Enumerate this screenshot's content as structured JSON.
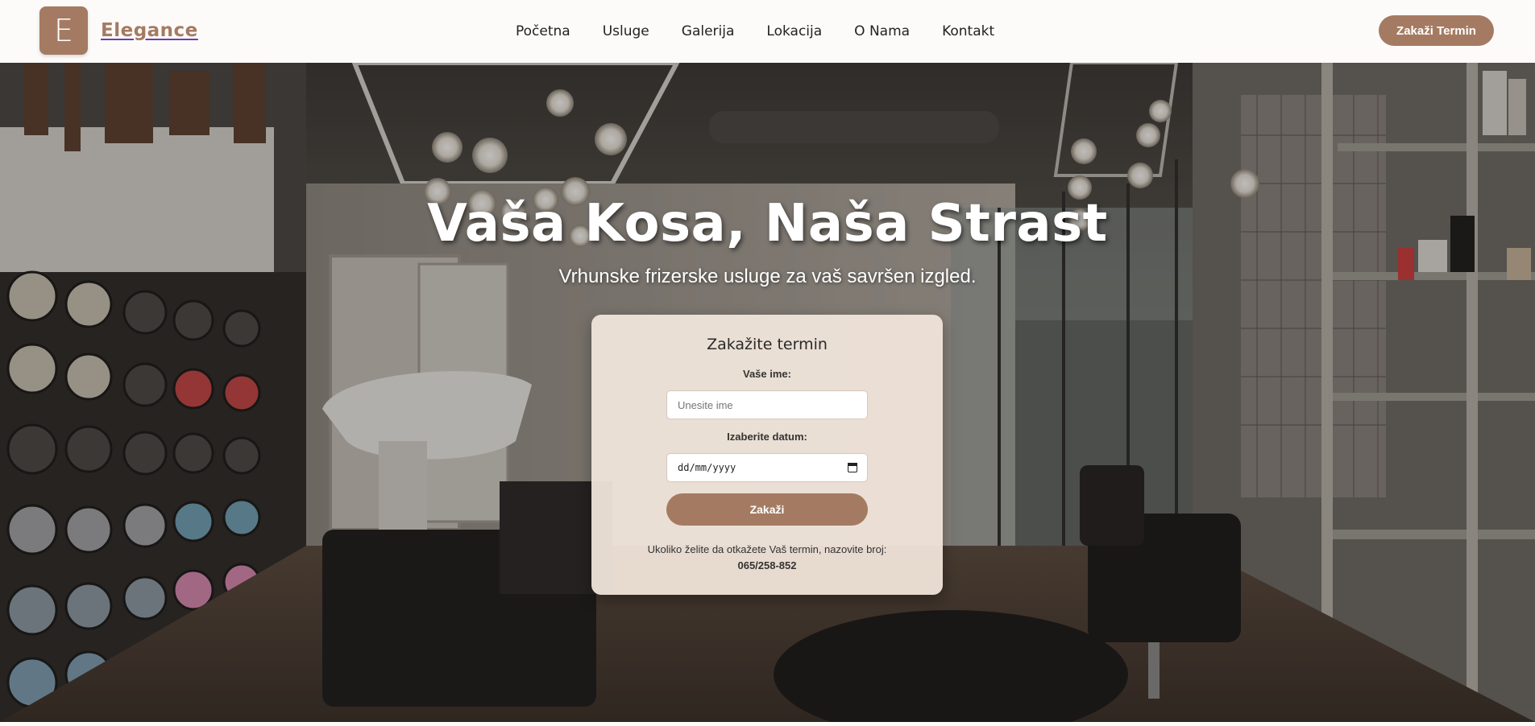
{
  "header": {
    "logo_letter": "E",
    "brand": "Elegance",
    "nav": [
      "Početna",
      "Usluge",
      "Galerija",
      "Lokacija",
      "O Nama",
      "Kontakt"
    ],
    "cta": "Zakaži Termin"
  },
  "hero": {
    "title": "Vaša Kosa, Naša Strast",
    "subtitle": "Vrhunske frizerske usluge za vaš savršen izgled."
  },
  "booking": {
    "title": "Zakažite termin",
    "name_label": "Vaše ime:",
    "name_placeholder": "Unesite ime",
    "date_label": "Izaberite datum:",
    "date_value": "dd/mm/yyyy",
    "submit": "Zakaži",
    "cancel_note": "Ukoliko želite da otkažete Vaš termin, nazovite broj:",
    "phone": "065/258-852"
  },
  "colors": {
    "accent": "#a47b62",
    "card_bg": "#f1e5db",
    "nav_bg": "#fdfbf9"
  },
  "icons": [
    "calendar-icon"
  ]
}
